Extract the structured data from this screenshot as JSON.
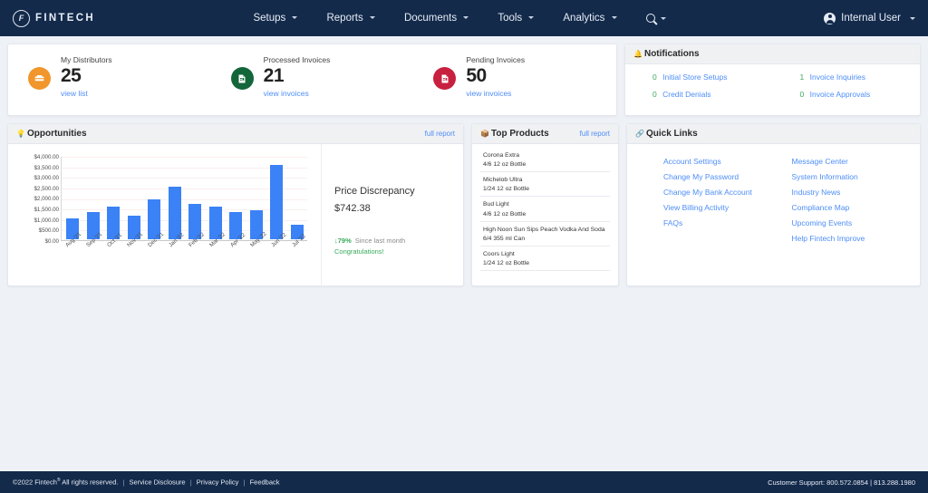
{
  "navbar": {
    "brand": "FINTECH",
    "brand_mark": "F",
    "items": [
      {
        "label": "Setups"
      },
      {
        "label": "Reports"
      },
      {
        "label": "Documents"
      },
      {
        "label": "Tools"
      },
      {
        "label": "Analytics"
      }
    ],
    "search_icon": "search-icon",
    "user": "Internal User"
  },
  "stats": [
    {
      "label": "My Distributors",
      "value": "25",
      "link": "view list",
      "color": "#f0962c",
      "icon": "distributor-icon"
    },
    {
      "label": "Processed Invoices",
      "value": "21",
      "link": "view invoices",
      "color": "#13663a",
      "icon": "invoice-icon"
    },
    {
      "label": "Pending Invoices",
      "value": "50",
      "link": "view invoices",
      "color": "#c8203f",
      "icon": "invoice-icon"
    }
  ],
  "notifications": {
    "title": "Notifications",
    "items": [
      {
        "count": "0",
        "label": "Initial Store Setups"
      },
      {
        "count": "1",
        "label": "Invoice Inquiries"
      },
      {
        "count": "0",
        "label": "Credit Denials"
      },
      {
        "count": "0",
        "label": "Invoice Approvals"
      }
    ]
  },
  "opportunities": {
    "title": "Opportunities",
    "full_report": "full report",
    "discrepancy": {
      "title": "Price Discrepancy",
      "value": "$742.38",
      "arrow": "↓",
      "percent": "79%",
      "since": "Since last month",
      "congrats": "Congratulations!"
    }
  },
  "chart_data": {
    "type": "bar",
    "title": "Opportunities",
    "xlabel": "",
    "ylabel": "",
    "ylim": [
      0,
      4000
    ],
    "ytick_labels": [
      "$4,000.00",
      "$3,500.00",
      "$3,000.00",
      "$2,500.00",
      "$2,000.00",
      "$1,500.00",
      "$1,000.00",
      "$500.00",
      "$0.00"
    ],
    "yticks": [
      4000,
      3500,
      3000,
      2500,
      2000,
      1500,
      1000,
      500,
      0
    ],
    "grid": true,
    "legend": "none",
    "categories": [
      "Aug '21",
      "Sep '21",
      "Oct '21",
      "Nov '21",
      "Dec '21",
      "Jan '22",
      "Feb '22",
      "Mar '22",
      "Apr '22",
      "May '22",
      "Jun '22",
      "Jul '22"
    ],
    "values": [
      980,
      1270,
      1550,
      1130,
      1900,
      2480,
      1660,
      1570,
      1300,
      1370,
      3530,
      700
    ],
    "bar_color": "#3b82f6"
  },
  "products": {
    "title": "Top Products",
    "full_report": "full report",
    "items": [
      {
        "name": "Corona Extra",
        "size": "4/6 12 oz Bottle"
      },
      {
        "name": "Michelob Ultra",
        "size": "1/24 12 oz Bottle"
      },
      {
        "name": "Bud Light",
        "size": "4/6 12 oz Bottle"
      },
      {
        "name": "High Noon Sun Sips Peach Vodka And Soda",
        "size": "6/4 355 ml Can"
      },
      {
        "name": "Coors Light",
        "size": "1/24 12 oz Bottle"
      }
    ]
  },
  "quick_links": {
    "title": "Quick Links",
    "left": [
      "Account Settings",
      "Change My Password",
      "Change My Bank Account",
      "View Billing Activity",
      "FAQs"
    ],
    "right": [
      "Message Center",
      "System Information",
      "Industry News",
      "Compliance Map",
      "Upcoming Events",
      "Help Fintech Improve"
    ]
  },
  "footer": {
    "copyright": "©2022 Fintech",
    "sup": "®",
    "rights": "All rights reserved.",
    "links": [
      "Service Disclosure",
      "Privacy Policy",
      "Feedback"
    ],
    "support": "Customer Support: 800.572.0854 | 813.288.1980"
  }
}
